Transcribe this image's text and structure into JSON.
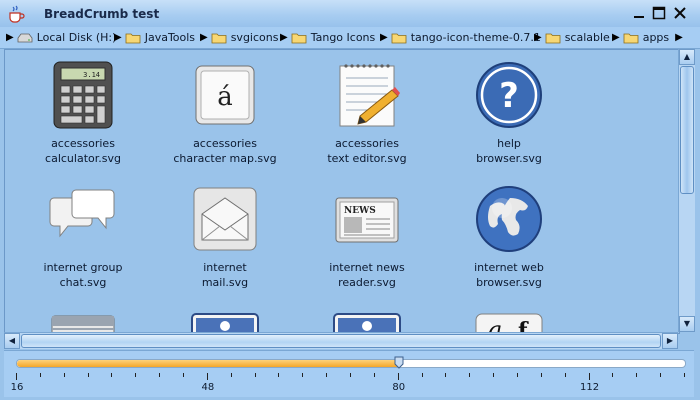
{
  "window": {
    "title": "BreadCrumb test"
  },
  "breadcrumb": [
    {
      "label": "Local Disk (H:)",
      "icon": "drive-icon"
    },
    {
      "label": "JavaTools",
      "icon": "folder-icon"
    },
    {
      "label": "svgicons",
      "icon": "folder-icon"
    },
    {
      "label": "Tango Icons",
      "icon": "folder-icon"
    },
    {
      "label": "tango-icon-theme-0.7.1",
      "icon": "folder-icon"
    },
    {
      "label": "scalable",
      "icon": "folder-icon"
    },
    {
      "label": "apps",
      "icon": "folder-icon"
    }
  ],
  "files": [
    {
      "line1": "accessories",
      "line2": "calculator.svg",
      "icon": "calculator-icon"
    },
    {
      "line1": "accessories",
      "line2": "character map.svg",
      "icon": "character-map-icon"
    },
    {
      "line1": "accessories",
      "line2": "text editor.svg",
      "icon": "text-editor-icon"
    },
    {
      "line1": "help",
      "line2": "browser.svg",
      "icon": "help-icon"
    },
    {
      "line1": "internet group",
      "line2": "chat.svg",
      "icon": "chat-icon"
    },
    {
      "line1": "internet",
      "line2": "mail.svg",
      "icon": "mail-icon"
    },
    {
      "line1": "internet news",
      "line2": "reader.svg",
      "icon": "news-icon"
    },
    {
      "line1": "internet web",
      "line2": "browser.svg",
      "icon": "globe-icon"
    },
    {
      "line1": "",
      "line2": "",
      "icon": "window-icon"
    },
    {
      "line1": "",
      "line2": "",
      "icon": "user-card-icon"
    },
    {
      "line1": "",
      "line2": "",
      "icon": "user-card-icon"
    },
    {
      "line1": "",
      "line2": "",
      "icon": "font-icon"
    }
  ],
  "calculator_display": "3.14",
  "charmap_glyph": "á",
  "news_header": "NEWS",
  "slider": {
    "min": 16,
    "max": 128,
    "value": 80,
    "major_ticks": [
      "16",
      "48",
      "80",
      "112"
    ],
    "accent": "#f4a62a"
  },
  "colors": {
    "background": "#9ac3ea",
    "titlebar": "#a8cdf1"
  }
}
